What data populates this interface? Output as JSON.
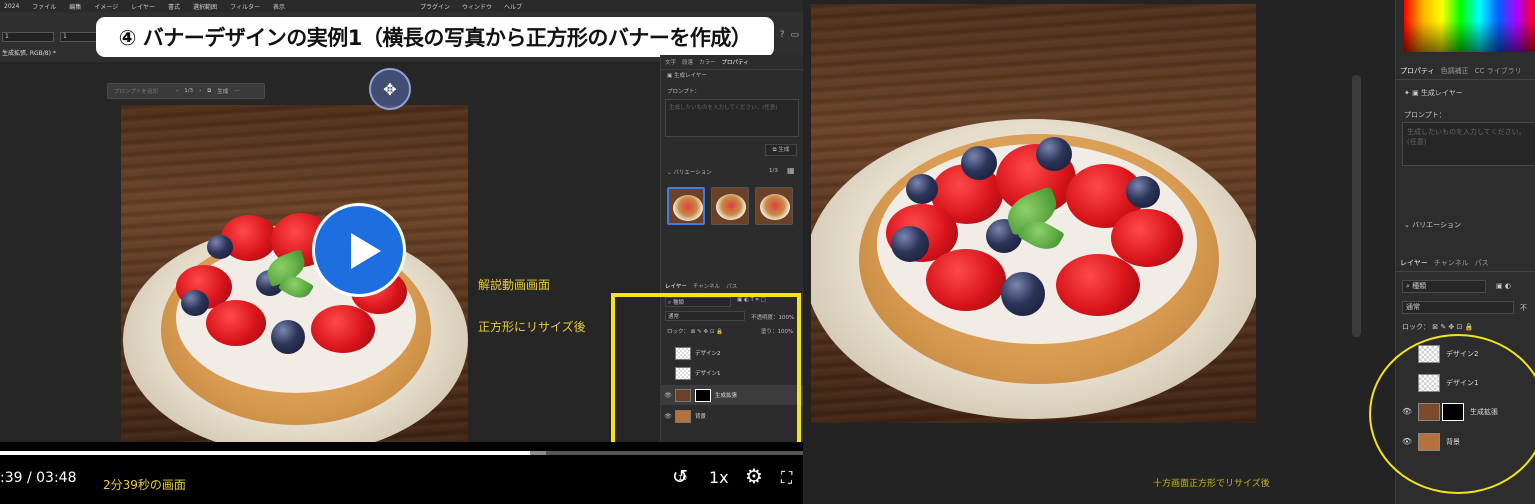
{
  "left": {
    "menubar": {
      "items": [
        "2024",
        "ファイル",
        "編集",
        "イメージ",
        "レイヤー",
        "書式",
        "選択範囲",
        "フィルター",
        "表示"
      ],
      "right_items": [
        "プラグイン",
        "ウィンドウ",
        "ヘルプ"
      ]
    },
    "optbar": {
      "field1": "1",
      "field2": "1",
      "doc_tab": "生成拡張, RGB/8) *"
    },
    "banner_title": "④ バナーデザインの実例1（横長の写真から正方形のバナーを作成）",
    "gen_toolbar": {
      "placeholder": "プロンプトを追加",
      "counter": "1/3",
      "generate_label": "生成",
      "more": "···"
    },
    "notes": {
      "video_screen": "解説動画画面",
      "resized_square": "正方形にリサイズ後"
    },
    "properties_panel": {
      "tabs": [
        "文字",
        "段落",
        "カラー",
        "プロパティ"
      ],
      "active_tab": "プロパティ",
      "layer_type": "生成レイヤー",
      "prompt_label": "プロンプト：",
      "prompt_placeholder": "生成したいものを入力してください。(任意)",
      "generate_button": "生成",
      "variations_label": "バリエーション",
      "variations_count": "1/3"
    },
    "layers_panel": {
      "tabs": [
        "レイヤー",
        "チャンネル",
        "パス"
      ],
      "active_tab": "レイヤー",
      "filter": "種類",
      "blend_mode": "通常",
      "opacity_label": "不透明度：",
      "opacity": "100%",
      "lock_label": "ロック：",
      "fill_label": "塗り：",
      "fill": "100%",
      "layers": [
        {
          "name": "デザイン2",
          "visible": false
        },
        {
          "name": "デザイン1",
          "visible": false
        },
        {
          "name": "生成拡張",
          "visible": true,
          "selected": true
        },
        {
          "name": "背景",
          "visible": true
        }
      ]
    },
    "player": {
      "time": ":39 / 03:48",
      "progress_fraction": 0.66,
      "buffer_fraction": 0.02,
      "caption": "2分39秒の画面",
      "speed": "1x",
      "replay_seconds": "10"
    }
  },
  "right": {
    "caption": "十方画面正方形でリサイズ後",
    "properties_tabs": [
      "プロパティ",
      "色調補正",
      "CC ライブラリ"
    ],
    "active_tab": "プロパティ",
    "layer_type": "生成レイヤー",
    "prompt_label": "プロンプト：",
    "prompt_placeholder": "生成したいものを入力してください。(任意)",
    "variations_label": "バリエーション",
    "layers_tabs": [
      "レイヤー",
      "チャンネル",
      "パス"
    ],
    "active_layers_tab": "レイヤー",
    "filter": "種類",
    "blend_mode": "通常",
    "opacity_label": "不",
    "lock_label": "ロック：",
    "layers": [
      {
        "name": "デザイン2",
        "visible": false
      },
      {
        "name": "デザイン1",
        "visible": false
      },
      {
        "name": "生成拡張",
        "visible": true
      },
      {
        "name": "背景",
        "visible": true
      }
    ]
  },
  "colors": {
    "accent_yellow": "#f4e21b",
    "play_blue": "#1d6fe0",
    "note_yellow": "#e9c93d"
  }
}
